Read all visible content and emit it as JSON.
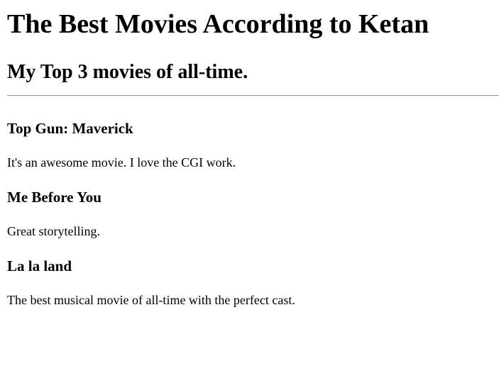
{
  "page": {
    "title": "The Best Movies According to Ketan",
    "subtitle": "My Top 3 movies of all-time."
  },
  "movies": [
    {
      "title": "Top Gun: Maverick",
      "description": "It's an awesome movie. I love the CGI work."
    },
    {
      "title": "Me Before You",
      "description": "Great storytelling."
    },
    {
      "title": "La la land",
      "description": "The best musical movie of all-time with the perfect cast."
    }
  ]
}
